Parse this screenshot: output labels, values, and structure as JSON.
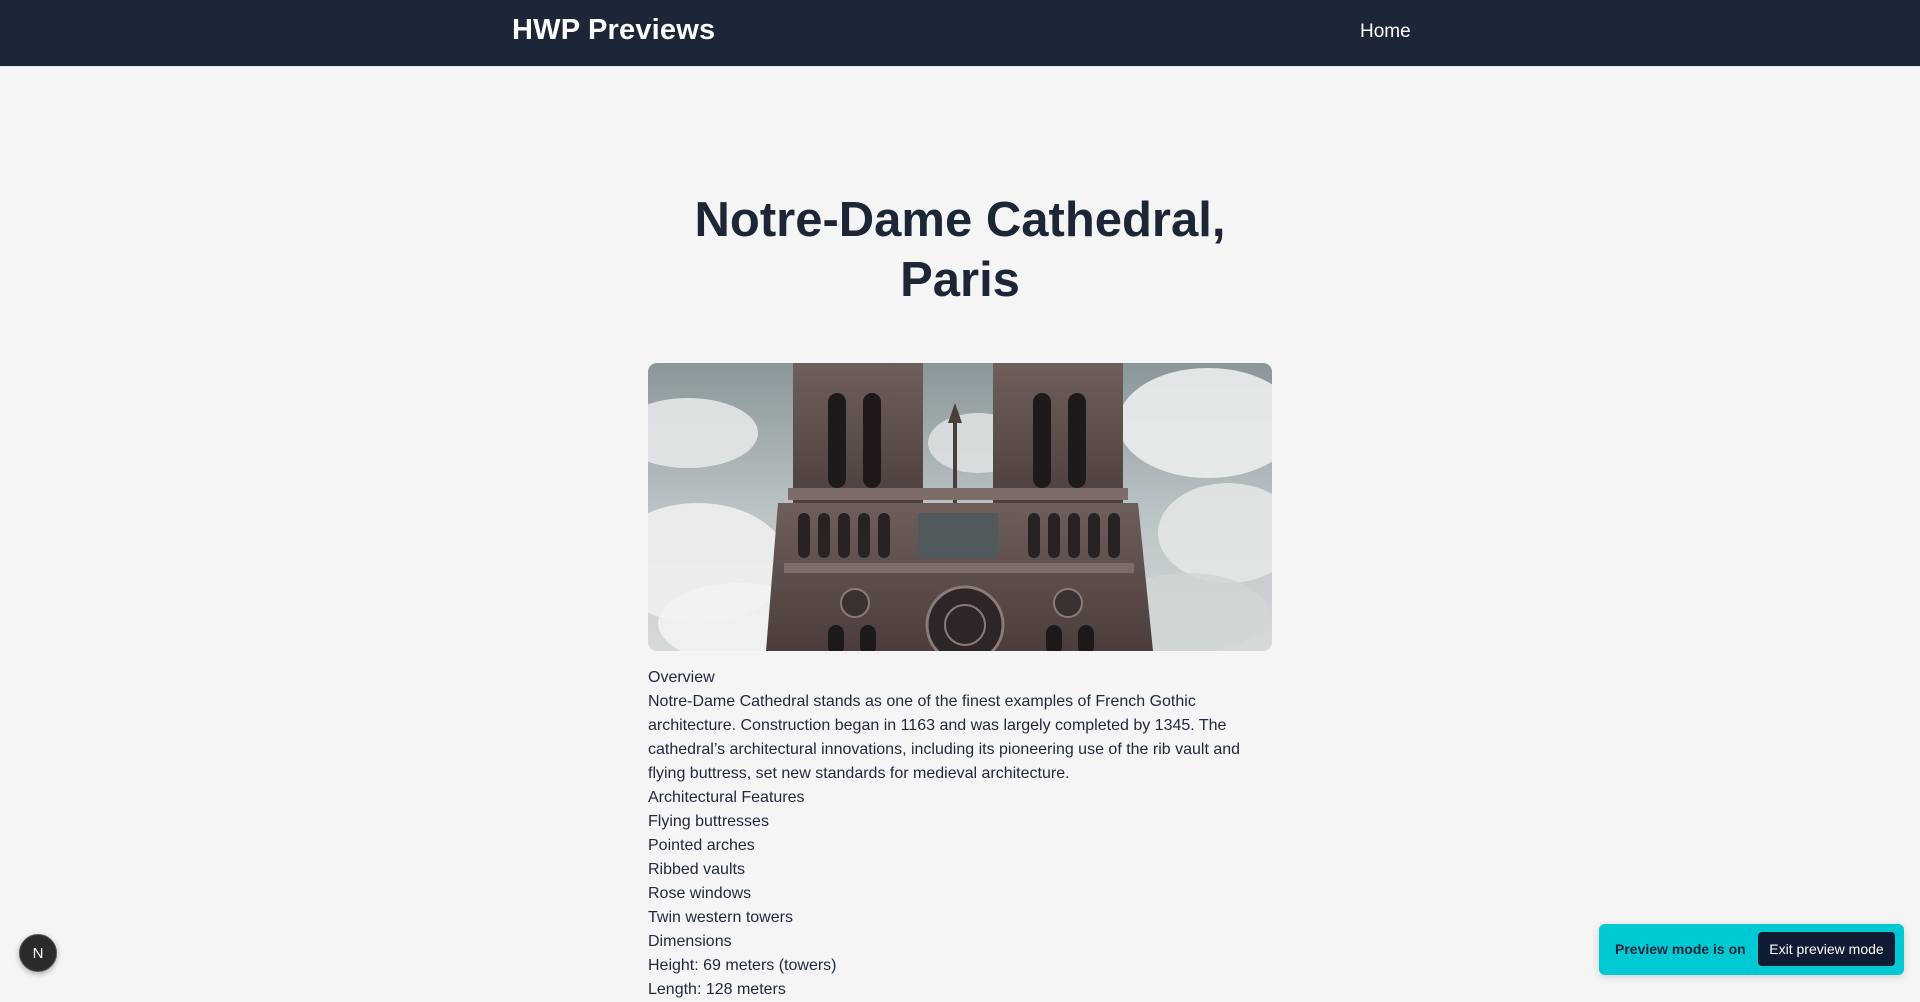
{
  "header": {
    "brand": "HWP Previews",
    "nav_home": "Home"
  },
  "post": {
    "title": "Notre-Dame Cathedral, Paris",
    "content": [
      "Overview",
      "Notre-Dame Cathedral stands as one of the finest examples of French Gothic architecture. Construction began in 1163 and was largely completed by 1345. The cathedral’s architectural innovations, including its pioneering use of the rib vault and flying buttress, set new standards for medieval architecture.",
      "Architectural Features",
      "Flying buttresses",
      "Pointed arches",
      "Ribbed vaults",
      "Rose windows",
      "Twin western towers",
      "Dimensions",
      "Height: 69 meters (towers)",
      "Length: 128 meters"
    ]
  },
  "nextjs_badge": {
    "letter": "N",
    "icon": "nextjs-logo-icon"
  },
  "preview_bar": {
    "status": "Preview mode is on",
    "exit_label": "Exit preview mode",
    "color": "#00c9d4"
  }
}
